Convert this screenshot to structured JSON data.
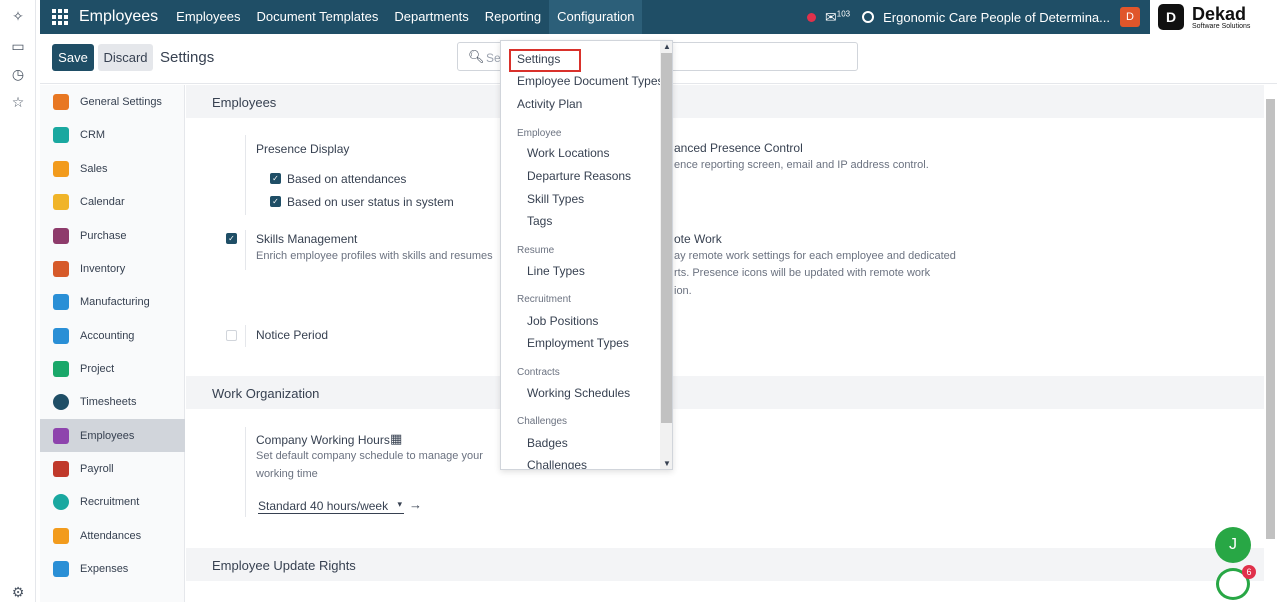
{
  "navbar": {
    "app_name": "Employees",
    "menu": [
      "Employees",
      "Document Templates",
      "Departments",
      "Reporting",
      "Configuration"
    ],
    "messages_count": "103",
    "company": "Ergonomic Care People of Determina...",
    "user_initial": "D",
    "brand_name": "Dekad",
    "brand_tagline": "Software Solutions"
  },
  "control": {
    "save_label": "Save",
    "discard_label": "Discard",
    "title": "Settings",
    "search_placeholder": "Se"
  },
  "sidebar": {
    "items": [
      {
        "label": "General Settings",
        "color": "#e87722"
      },
      {
        "label": "CRM",
        "color": "#1aa8a0"
      },
      {
        "label": "Sales",
        "color": "#f29b1d"
      },
      {
        "label": "Calendar",
        "color": "#f0b429"
      },
      {
        "label": "Purchase",
        "color": "#8e3b6b"
      },
      {
        "label": "Inventory",
        "color": "#d65a2a"
      },
      {
        "label": "Manufacturing",
        "color": "#2a8fd6"
      },
      {
        "label": "Accounting",
        "color": "#2a8fd6"
      },
      {
        "label": "Project",
        "color": "#1aa86a"
      },
      {
        "label": "Timesheets",
        "color": "#1f4e66"
      },
      {
        "label": "Employees",
        "color": "#8e44ad"
      },
      {
        "label": "Payroll",
        "color": "#c0392b"
      },
      {
        "label": "Recruitment",
        "color": "#1aa8a0"
      },
      {
        "label": "Attendances",
        "color": "#f29b1d"
      },
      {
        "label": "Expenses",
        "color": "#2a8fd6"
      }
    ]
  },
  "main": {
    "sections": [
      "Employees",
      "Work Organization",
      "Employee Update Rights"
    ],
    "presence_display": "Presence Display",
    "based_on_attendances": "Based on attendances",
    "based_on_status": "Based on user status in system",
    "skills_title": "Skills Management",
    "skills_desc": "Enrich employee profiles with skills and resumes",
    "notice_period": "Notice Period",
    "advanced_presence_title": "anced Presence Control",
    "advanced_presence_desc": "ence reporting screen, email and IP address control.",
    "remote_work_title": "ote Work",
    "remote_work_desc1": "ay remote work settings for each employee and dedicated",
    "remote_work_desc2": "rts. Presence icons will be updated with remote work",
    "remote_work_desc3": "ion.",
    "company_hours_title": "Company Working Hours",
    "company_hours_desc1": "Set default company schedule to manage your",
    "company_hours_desc2": "working time",
    "working_schedule_value": "Standard 40 hours/week"
  },
  "dropdown": {
    "top_items": [
      "Settings",
      "Employee Document Types",
      "Activity Plan"
    ],
    "groups": [
      {
        "header": "Employee",
        "items": [
          "Work Locations",
          "Departure Reasons",
          "Skill Types",
          "Tags"
        ]
      },
      {
        "header": "Resume",
        "items": [
          "Line Types"
        ]
      },
      {
        "header": "Recruitment",
        "items": [
          "Job Positions",
          "Employment Types"
        ]
      },
      {
        "header": "Contracts",
        "items": [
          "Working Schedules"
        ]
      },
      {
        "header": "Challenges",
        "items": [
          "Badges",
          "Challenges"
        ]
      }
    ]
  },
  "floating": {
    "chat_initial": "J",
    "bot_badge": "6"
  },
  "colors": {
    "primary": "#1f4e66",
    "highlight_border": "#d9312b",
    "chat_green": "#28a745"
  }
}
